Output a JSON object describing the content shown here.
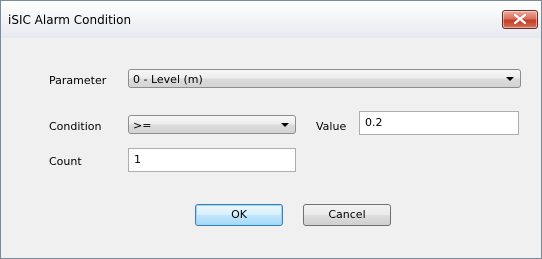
{
  "window": {
    "title": "iSIC Alarm Condition",
    "close_icon": "close-icon"
  },
  "form": {
    "parameter": {
      "label": "Parameter",
      "selected": "0 - Level (m)"
    },
    "condition": {
      "label": "Condition",
      "selected": ">="
    },
    "value": {
      "label": "Value",
      "text": "0.2"
    },
    "count": {
      "label": "Count",
      "text": "1"
    }
  },
  "buttons": {
    "ok": "OK",
    "cancel": "Cancel"
  },
  "colors": {
    "dialog_background": "#f0f0f0",
    "close_button": "#c43c25",
    "default_button_border": "#3c7fb1"
  }
}
